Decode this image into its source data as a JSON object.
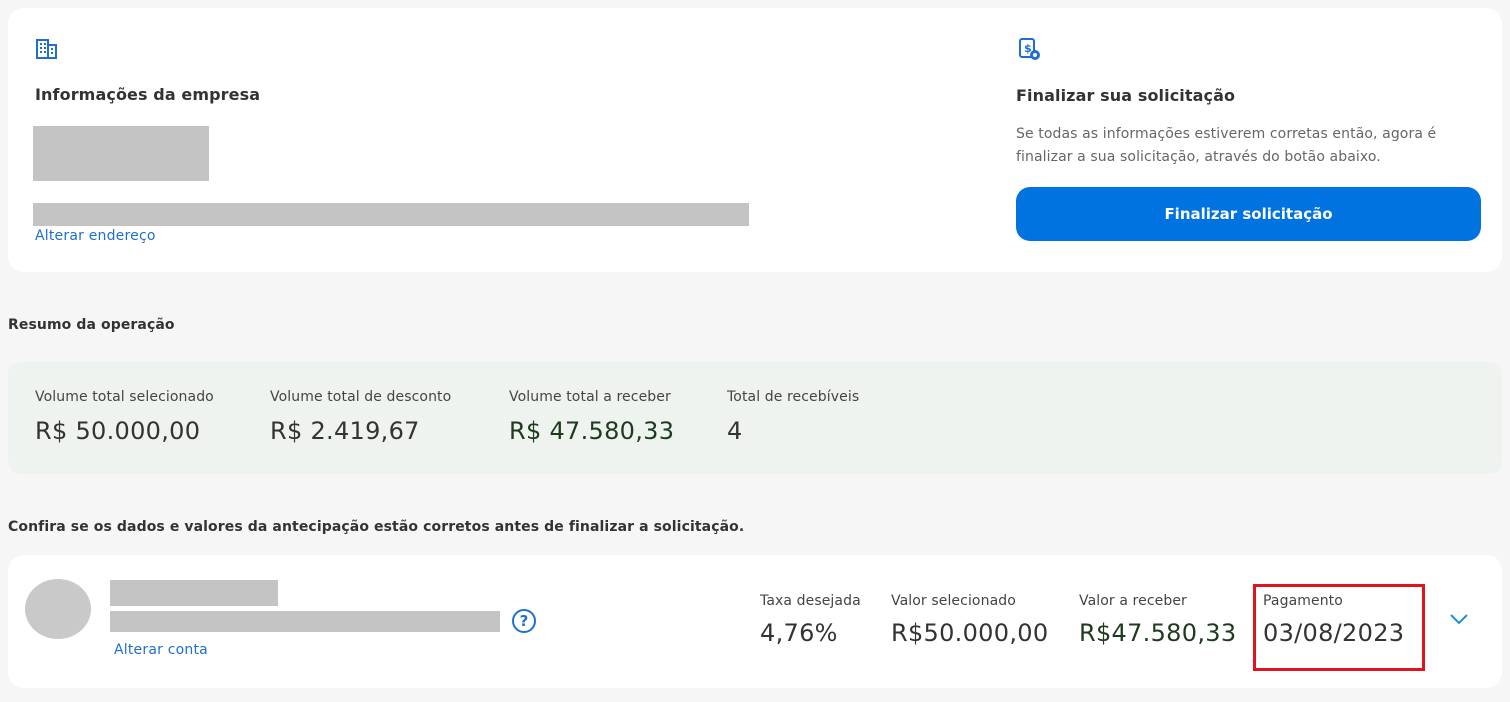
{
  "company": {
    "title": "Informações da empresa",
    "change_address_link": "Alterar endereço",
    "icon": "building-icon"
  },
  "finalize": {
    "icon": "document-money-icon",
    "title": "Finalizar sua solicitação",
    "description": "Se todas as informações estiverem corretas então, agora é finalizar a sua solicitação, através do botão abaixo.",
    "button_label": "Finalizar solicitação",
    "button_color": "#0073e0"
  },
  "summary": {
    "section_title": "Resumo da operação",
    "stats": [
      {
        "label": "Volume total selecionado",
        "value": "R$ 50.000,00"
      },
      {
        "label": "Volume total de desconto",
        "value": "R$ 2.419,67"
      },
      {
        "label": "Volume total a receber",
        "value": "R$ 47.580,33"
      },
      {
        "label": "Total de recebíveis",
        "value": "4"
      }
    ]
  },
  "review": {
    "section_title": "Confira se os dados e valores da antecipação estão corretos antes de finalizar a solicitação.",
    "change_account_link": "Alterar conta",
    "help_glyph": "?",
    "columns": [
      {
        "label": "Taxa desejada",
        "value": "4,76%"
      },
      {
        "label": "Valor selecionado",
        "value": "R$50.000,00"
      },
      {
        "label": "Valor a receber",
        "value": "R$47.580,33"
      },
      {
        "label": "Pagamento",
        "value": "03/08/2023"
      }
    ],
    "highlight_color": "#e0131f"
  }
}
